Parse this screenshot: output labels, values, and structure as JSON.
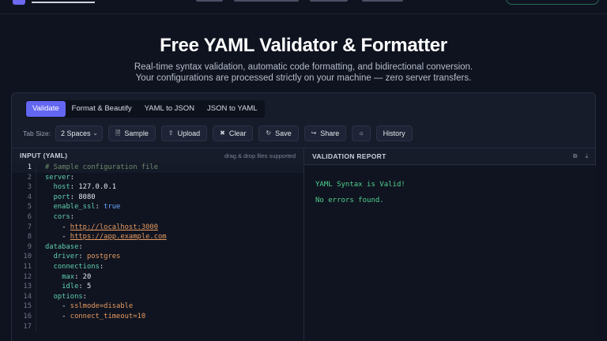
{
  "hero": {
    "title": "Free YAML Validator & Formatter",
    "subtitle_line1": "Real-time syntax validation, automatic code formatting, and bidirectional conversion.",
    "subtitle_line2": "Your configurations are processed strictly on your machine — zero server transfers."
  },
  "tabs": [
    "Validate",
    "Format & Beautify",
    "YAML to JSON",
    "JSON to YAML"
  ],
  "toolbar": {
    "tab_size_label": "Tab Size:",
    "tab_size_value": "2 Spaces",
    "buttons": {
      "sample": "Sample",
      "upload": "Upload",
      "clear": "Clear",
      "save": "Save",
      "share": "Share",
      "history": "History"
    }
  },
  "editor": {
    "title": "INPUT (YAML)",
    "hint": "drag & drop files supported",
    "current_line": 1,
    "lines": [
      {
        "n": "1",
        "indent": "",
        "comment": "# Sample configuration file"
      },
      {
        "n": "2",
        "indent": "",
        "key": "server",
        "sep": ":"
      },
      {
        "n": "3",
        "indent": "  ",
        "key": "host",
        "sep": ": ",
        "val": "127.0.0.1",
        "vt": "num"
      },
      {
        "n": "4",
        "indent": "  ",
        "key": "port",
        "sep": ": ",
        "val": "8080",
        "vt": "num"
      },
      {
        "n": "5",
        "indent": "  ",
        "key": "enable_ssl",
        "sep": ": ",
        "val": "true",
        "vt": "bool"
      },
      {
        "n": "6",
        "indent": "  ",
        "key": "cors",
        "sep": ":"
      },
      {
        "n": "7",
        "indent": "    ",
        "dash": "- ",
        "val": "http://localhost:3000",
        "vt": "url"
      },
      {
        "n": "8",
        "indent": "    ",
        "dash": "- ",
        "val": "https://app.example.com",
        "vt": "url"
      },
      {
        "n": "9",
        "indent": "",
        "key": "database",
        "sep": ":"
      },
      {
        "n": "10",
        "indent": "  ",
        "key": "driver",
        "sep": ": ",
        "val": "postgres",
        "vt": "str"
      },
      {
        "n": "11",
        "indent": "  ",
        "key": "connections",
        "sep": ":"
      },
      {
        "n": "12",
        "indent": "    ",
        "key": "max",
        "sep": ": ",
        "val": "20",
        "vt": "num"
      },
      {
        "n": "13",
        "indent": "    ",
        "key": "idle",
        "sep": ": ",
        "val": "5",
        "vt": "num"
      },
      {
        "n": "14",
        "indent": "  ",
        "key": "options",
        "sep": ":"
      },
      {
        "n": "15",
        "indent": "    ",
        "dash": "- ",
        "val": "sslmode=disable",
        "vt": "str"
      },
      {
        "n": "16",
        "indent": "    ",
        "dash": "- ",
        "val": "connect_timeout=10",
        "vt": "str"
      },
      {
        "n": "17",
        "indent": ""
      }
    ]
  },
  "report": {
    "title": "VALIDATION REPORT",
    "line1": "YAML Syntax is Valid!",
    "line2": "No errors found."
  },
  "colors": {
    "accent": "#6366f1",
    "success": "#4fd08f",
    "key": "#5ed0b0",
    "string": "#e59a62"
  },
  "icons": {
    "sample": "file-icon",
    "upload": "upload-icon",
    "clear": "trash-icon",
    "save": "save-icon",
    "share": "share-icon",
    "theme": "sun-icon",
    "copy": "copy-icon",
    "download": "download-icon"
  }
}
